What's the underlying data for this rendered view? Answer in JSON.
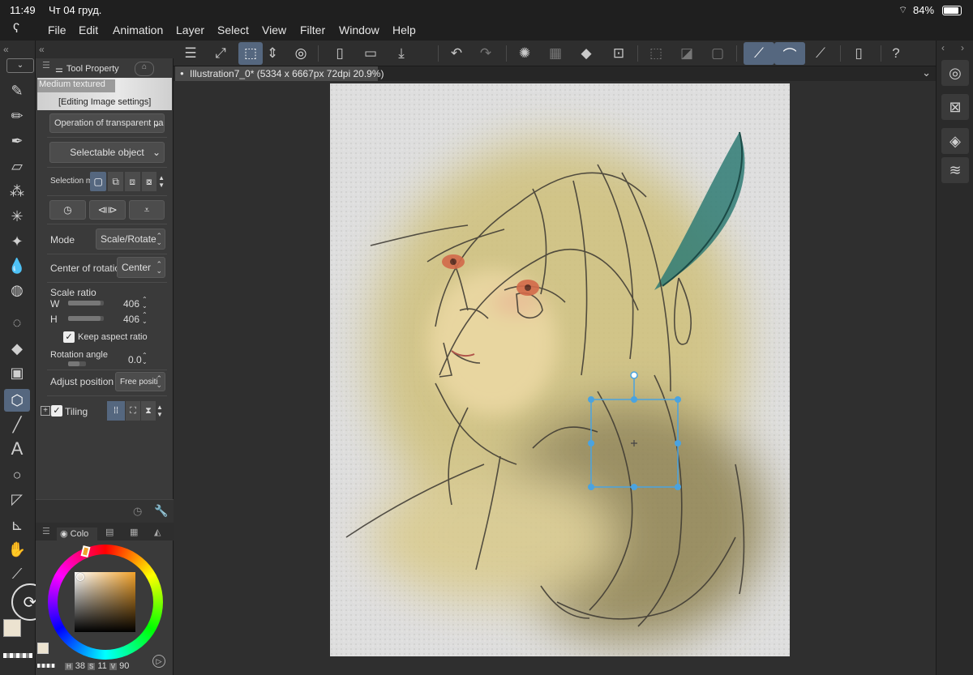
{
  "status": {
    "time": "11:49",
    "date": "Чт 04 груд.",
    "battery": "84%"
  },
  "menu": [
    "File",
    "Edit",
    "Animation",
    "Layer",
    "Select",
    "View",
    "Filter",
    "Window",
    "Help"
  ],
  "panel": {
    "tab_label": "Tool Property",
    "preset_name": "Medium textured",
    "editing_title": "[Editing Image settings]",
    "transparent_dropdown": "Operation of transparent part",
    "selectable_object": "Selectable object",
    "selection_mode_label": "Selection m",
    "mode_label": "Mode",
    "mode_value": "Scale/Rotate",
    "center_label": "Center of rotation",
    "center_value": "Center",
    "scale_label": "Scale ratio",
    "w_label": "W",
    "w_value": "406",
    "h_label": "H",
    "h_value": "406",
    "keep_aspect_label": "Keep aspect ratio",
    "rotation_label": "Rotation angle",
    "rotation_value": "0.0",
    "adjust_label": "Adjust position",
    "adjust_value": "Free positi",
    "tiling_label": "Tiling"
  },
  "color_panel": {
    "tab_label": "Colo",
    "h_label": "H",
    "h_value": "38",
    "s_label": "S",
    "s_value": "11",
    "v_label": "V",
    "v_value": "90",
    "main_color": "#ece3d0",
    "picker_hue": "#f2a22a"
  },
  "document": {
    "tab_title": "Illustration7_0* (5334 x 6667px 72dpi 20.9%)"
  },
  "colors": {
    "accent": "#55677f",
    "selection": "#4aa3e0"
  }
}
